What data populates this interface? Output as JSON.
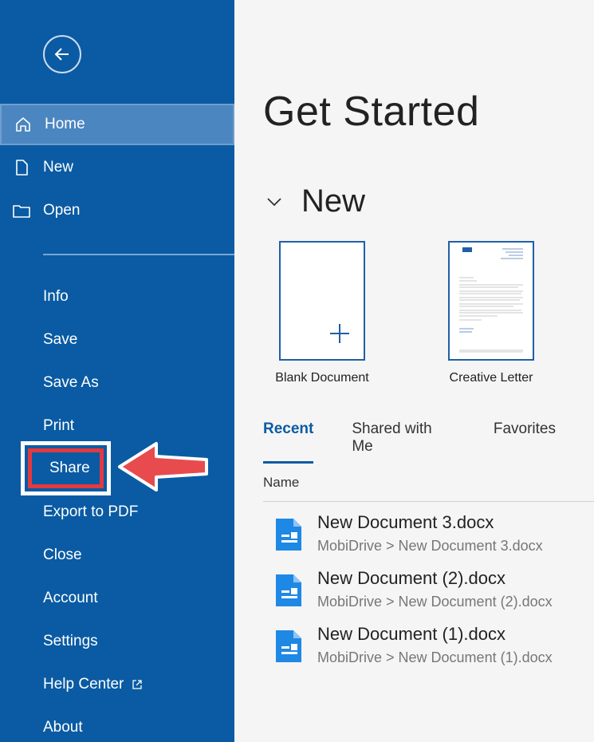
{
  "sidebar": {
    "primary": [
      {
        "label": "Home",
        "icon": "home-icon"
      },
      {
        "label": "New",
        "icon": "new-file-icon"
      },
      {
        "label": "Open",
        "icon": "folder-icon"
      }
    ],
    "secondary": [
      "Info",
      "Save",
      "Save As",
      "Print",
      "Share",
      "Export to PDF",
      "Close",
      "Account",
      "Settings",
      "Help Center",
      "About"
    ]
  },
  "main": {
    "title": "Get Started",
    "new_section": "New",
    "templates": [
      {
        "label": "Blank Document"
      },
      {
        "label": "Creative Letter"
      }
    ],
    "tabs": [
      "Recent",
      "Shared with Me",
      "Favorites"
    ],
    "column_name": "Name",
    "files": [
      {
        "name": "New Document 3.docx",
        "path": "MobiDrive > New Document 3.docx"
      },
      {
        "name": "New Document (2).docx",
        "path": "MobiDrive > New Document (2).docx"
      },
      {
        "name": "New Document (1).docx",
        "path": "MobiDrive > New Document (1).docx"
      }
    ]
  },
  "colors": {
    "sidebar_bg": "#0a5ba3",
    "accent": "#0a5ba3",
    "highlight": "#e3393f"
  }
}
